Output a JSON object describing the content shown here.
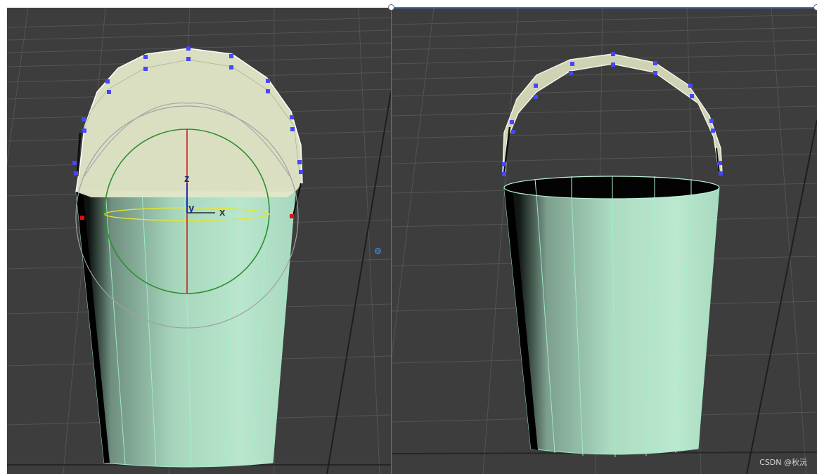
{
  "viewports": {
    "left": {
      "name": "perspective-viewport-left"
    },
    "right": {
      "name": "perspective-viewport-right"
    }
  },
  "gizmo": {
    "axis_z": "z",
    "axis_y": "y",
    "axis_x": "x"
  },
  "colors": {
    "viewport_bg": "#3d3d3d",
    "grid_line": "#525252",
    "mesh_face": "#b7e3cb",
    "selection_face": "#e2e6c8",
    "vertex": "#4646ff",
    "active_viewport_border": "#2f7fd6"
  },
  "watermark": "CSDN @秋沅"
}
